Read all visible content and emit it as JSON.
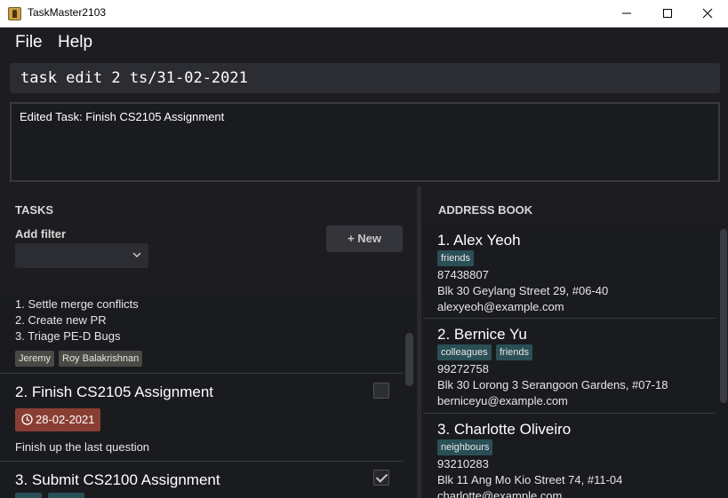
{
  "window": {
    "title": "TaskMaster2103"
  },
  "menu": {
    "file": "File",
    "help": "Help"
  },
  "command": {
    "text": "task edit 2 ts/31-02-2021"
  },
  "result": {
    "text": "Edited Task: Finish CS2105 Assignment"
  },
  "tasks_panel": {
    "title": "TASKS",
    "filter_label": "Add filter",
    "filter_value": "",
    "new_button": "+ New",
    "tasks": [
      {
        "subtasks": [
          "1. Settle merge conflicts",
          "2. Create new PR",
          "3. Triage PE-D Bugs"
        ],
        "people": [
          "Jeremy",
          "Roy Balakrishnan"
        ]
      },
      {
        "title": "2.  Finish CS2105 Assignment",
        "completed": false,
        "date": "28-02-2021",
        "description": "Finish up the last question"
      },
      {
        "title": "3.  Submit CS2100 Assignment",
        "completed": true
      }
    ]
  },
  "address_panel": {
    "title": "ADDRESS BOOK",
    "persons": [
      {
        "name": "1.  Alex Yeoh",
        "tags": [
          "friends"
        ],
        "phone": "87438807",
        "address": "Blk 30 Geylang Street 29, #06-40",
        "email": "alexyeoh@example.com"
      },
      {
        "name": "2.  Bernice Yu",
        "tags": [
          "colleagues",
          "friends"
        ],
        "phone": "99272758",
        "address": "Blk 30 Lorong 3 Serangoon Gardens, #07-18",
        "email": "berniceyu@example.com"
      },
      {
        "name": "3.  Charlotte Oliveiro",
        "tags": [
          "neighbours"
        ],
        "phone": "93210283",
        "address": "Blk 11 Ang Mo Kio Street 74, #11-04",
        "email": "charlotte@example.com"
      }
    ]
  },
  "colors": {
    "background": "#1d1d21",
    "tag": "#2b4f56",
    "date_badge": "#8a3e33",
    "person_chip": "#4a4a45"
  },
  "icons": {
    "app": "app-icon",
    "minimize": "minimize-icon",
    "maximize": "maximize-icon",
    "close": "close-icon",
    "dropdown": "chevron-down-icon",
    "date": "clock-icon",
    "checkbox": "checkbox-icon"
  }
}
